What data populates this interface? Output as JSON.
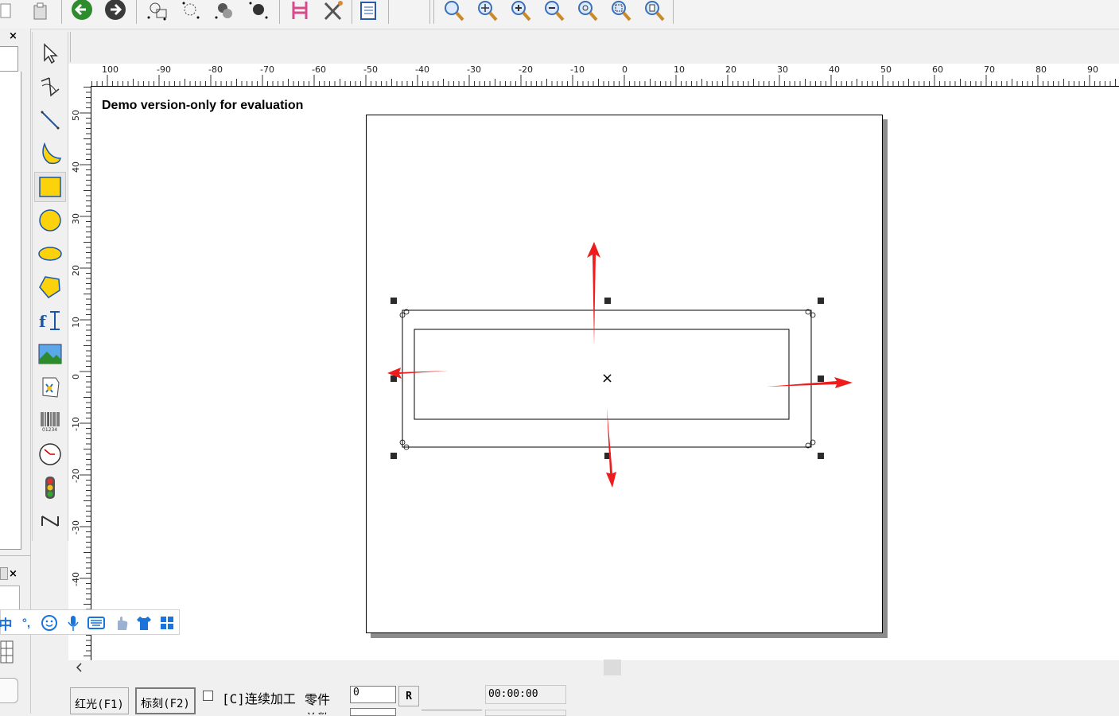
{
  "toolbar": {
    "icons": [
      "copy-icon",
      "paste-icon",
      "back-arrow-icon",
      "forward-arrow-icon",
      "node-edit-icon",
      "node-select-icon",
      "node-add-icon",
      "node-delete-icon",
      "hatch-icon",
      "tools-icon",
      "list-icon",
      "zoom-icon",
      "zoom-pan-icon",
      "zoom-in-icon",
      "zoom-out-icon",
      "zoom-all-icon",
      "zoom-selection-icon",
      "zoom-page-icon"
    ]
  },
  "tools": [
    "select",
    "curve-edit",
    "line",
    "curve-fill",
    "rectangle",
    "circle",
    "ellipse",
    "polygon",
    "text",
    "bitmap",
    "vector-file",
    "barcode",
    "timer",
    "io-signal",
    "axis"
  ],
  "panel": {
    "close_symbol": "×"
  },
  "canvas": {
    "watermark": "Demo version-only for evaluation",
    "ruler_h_labels": [
      "100",
      "-90",
      "-80",
      "-70",
      "-60",
      "-50",
      "-40",
      "-30",
      "-20",
      "-10",
      "0",
      "10",
      "20",
      "30",
      "40",
      "50",
      "60",
      "70",
      "80",
      "90"
    ],
    "ruler_v_labels": [
      "50",
      "40",
      "30",
      "20",
      "10",
      "0",
      "-10",
      "-20",
      "-30",
      "-40"
    ],
    "center_mark": "×"
  },
  "ime": {
    "label": "中",
    "punct": "°,"
  },
  "bottom": {
    "red_light_button": "红光(F1)",
    "mark_button": "标刻(F2)",
    "continuous_label": "[C]连续加工",
    "parts_label": "零件",
    "parts_value": "0",
    "reset_button": "R",
    "time_value": "00:00:00",
    "total_label": "总数"
  },
  "colors": {
    "accent_arrow": "#ee1c1c",
    "tool_yellow": "#fcd20c"
  }
}
